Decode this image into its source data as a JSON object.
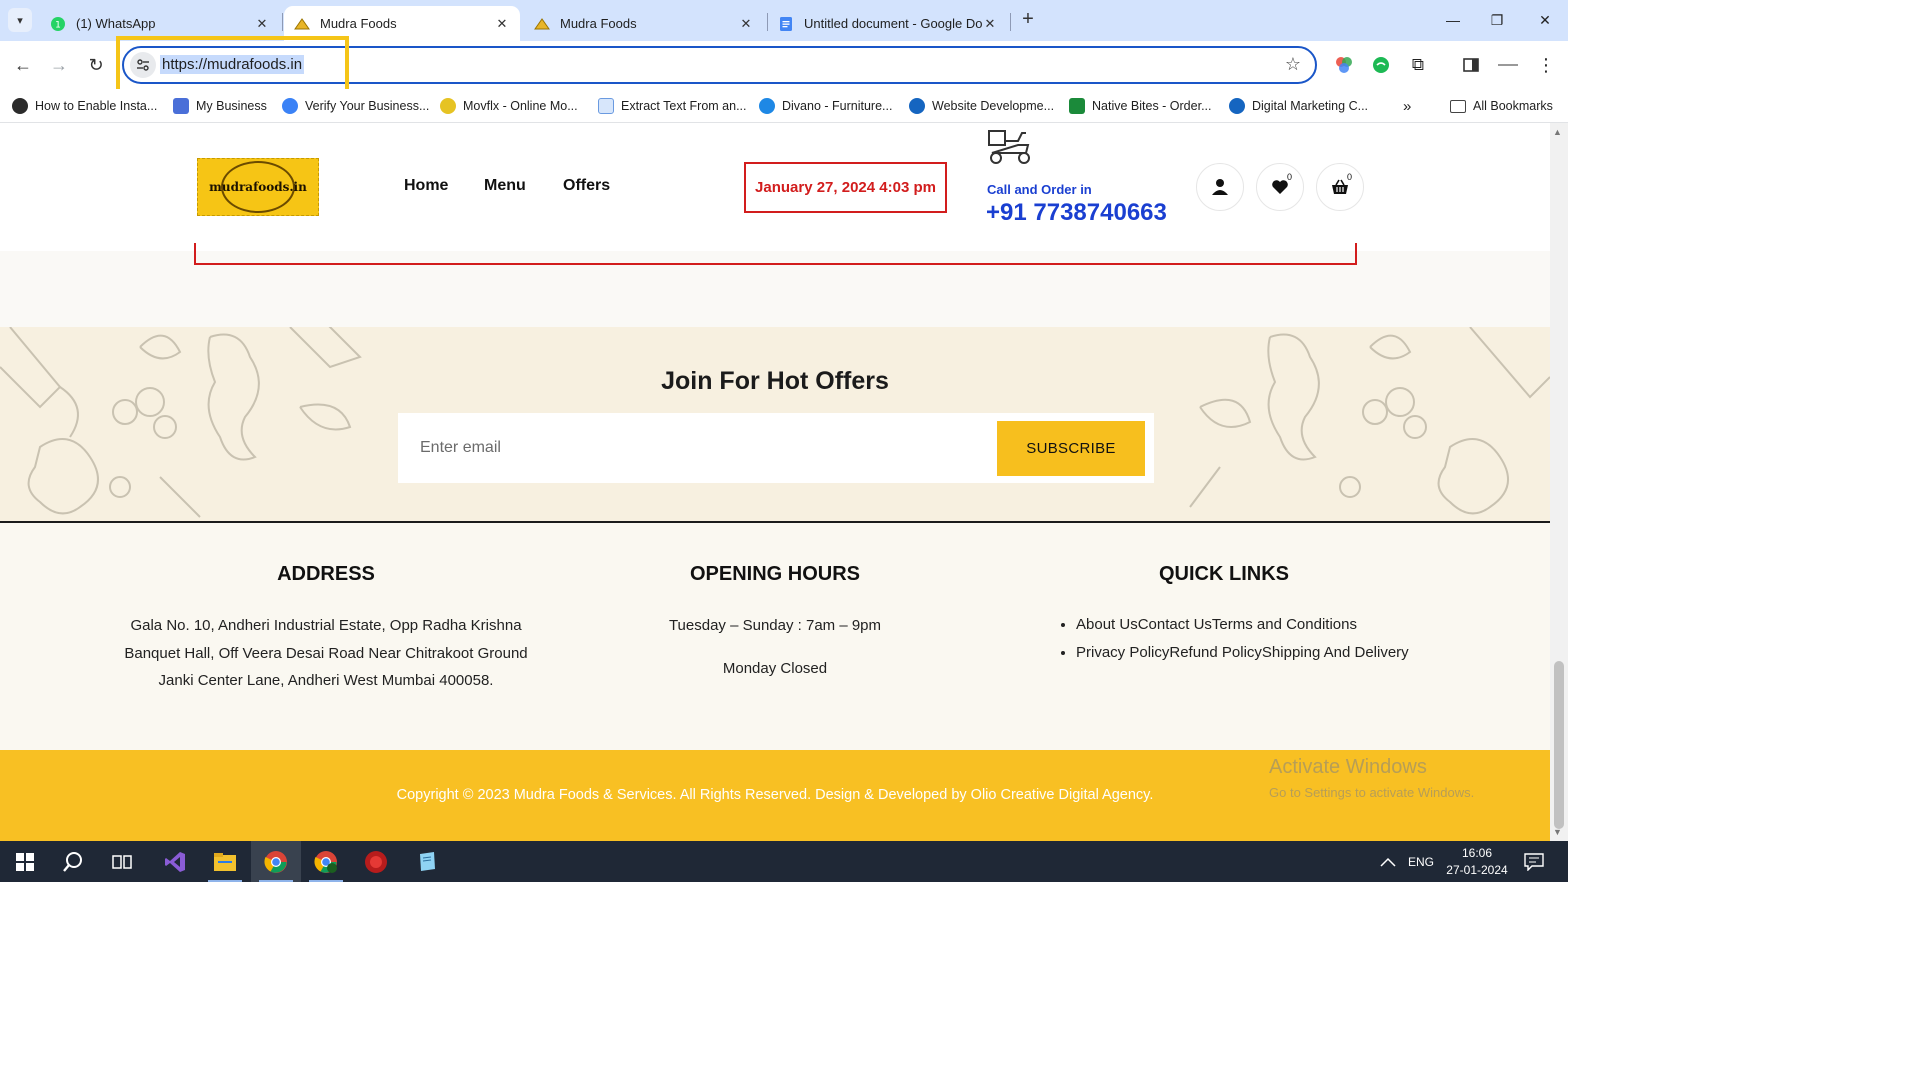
{
  "browser": {
    "tabs": [
      {
        "title": "(1) WhatsApp",
        "active": false
      },
      {
        "title": "Mudra Foods",
        "active": true
      },
      {
        "title": "Mudra Foods",
        "active": false
      },
      {
        "title": "Untitled document - Google Docs",
        "active": false
      }
    ],
    "url": "https://mudrafoods.in",
    "bookmarks": [
      "How to Enable Insta...",
      "My Business",
      "Verify Your Business...",
      "Movflx - Online Mo...",
      "Extract Text From an...",
      "Divano - Furniture...",
      "Website Developme...",
      "Native Bites - Order...",
      "Digital Marketing C..."
    ],
    "all_bookmarks": "All Bookmarks"
  },
  "site": {
    "logo_text": "mudrafoods.in",
    "nav": [
      "Home",
      "Menu",
      "Offers"
    ],
    "datetime": "January 27, 2024 4:03 pm",
    "call_label": "Call and Order in",
    "phone": "+91 7738740663",
    "wishlist_count": "0",
    "cart_count": "0"
  },
  "newsletter": {
    "title": "Join For Hot Offers",
    "placeholder": "Enter email",
    "button": "SUBSCRIBE"
  },
  "footer": {
    "address": {
      "heading": "ADDRESS",
      "lines": [
        "Gala No. 10, Andheri Industrial Estate, Opp Radha Krishna",
        "Banquet Hall, Off Veera Desai Road Near Chitrakoot Ground",
        "Janki Center Lane,  Andheri West Mumbai 400058."
      ]
    },
    "hours": {
      "heading": "OPENING HOURS",
      "line1": "Tuesday – Sunday : 7am – 9pm",
      "line2": "Monday Closed"
    },
    "quick_links": {
      "heading": "QUICK LINKS",
      "items": [
        "About Us",
        "Contact Us",
        "Terms and Conditions",
        "Privacy Policy",
        "Refund Policy",
        "Shipping And Delivery"
      ]
    },
    "copyright": "Copyright © 2023 Mudra Foods & Services. All Rights Reserved. Design & Developed by Olio Creative Digital Agency."
  },
  "windows_watermark": {
    "line1": "Activate Windows",
    "line2": "Go to Settings to activate Windows."
  },
  "taskbar": {
    "language": "ENG",
    "time": "16:06",
    "date": "27-01-2024"
  },
  "colors": {
    "accent_yellow": "#f7bf1e",
    "date_red": "#d21d1d",
    "phone_blue": "#1a3fd1",
    "highlight_box": "#f5c518"
  }
}
